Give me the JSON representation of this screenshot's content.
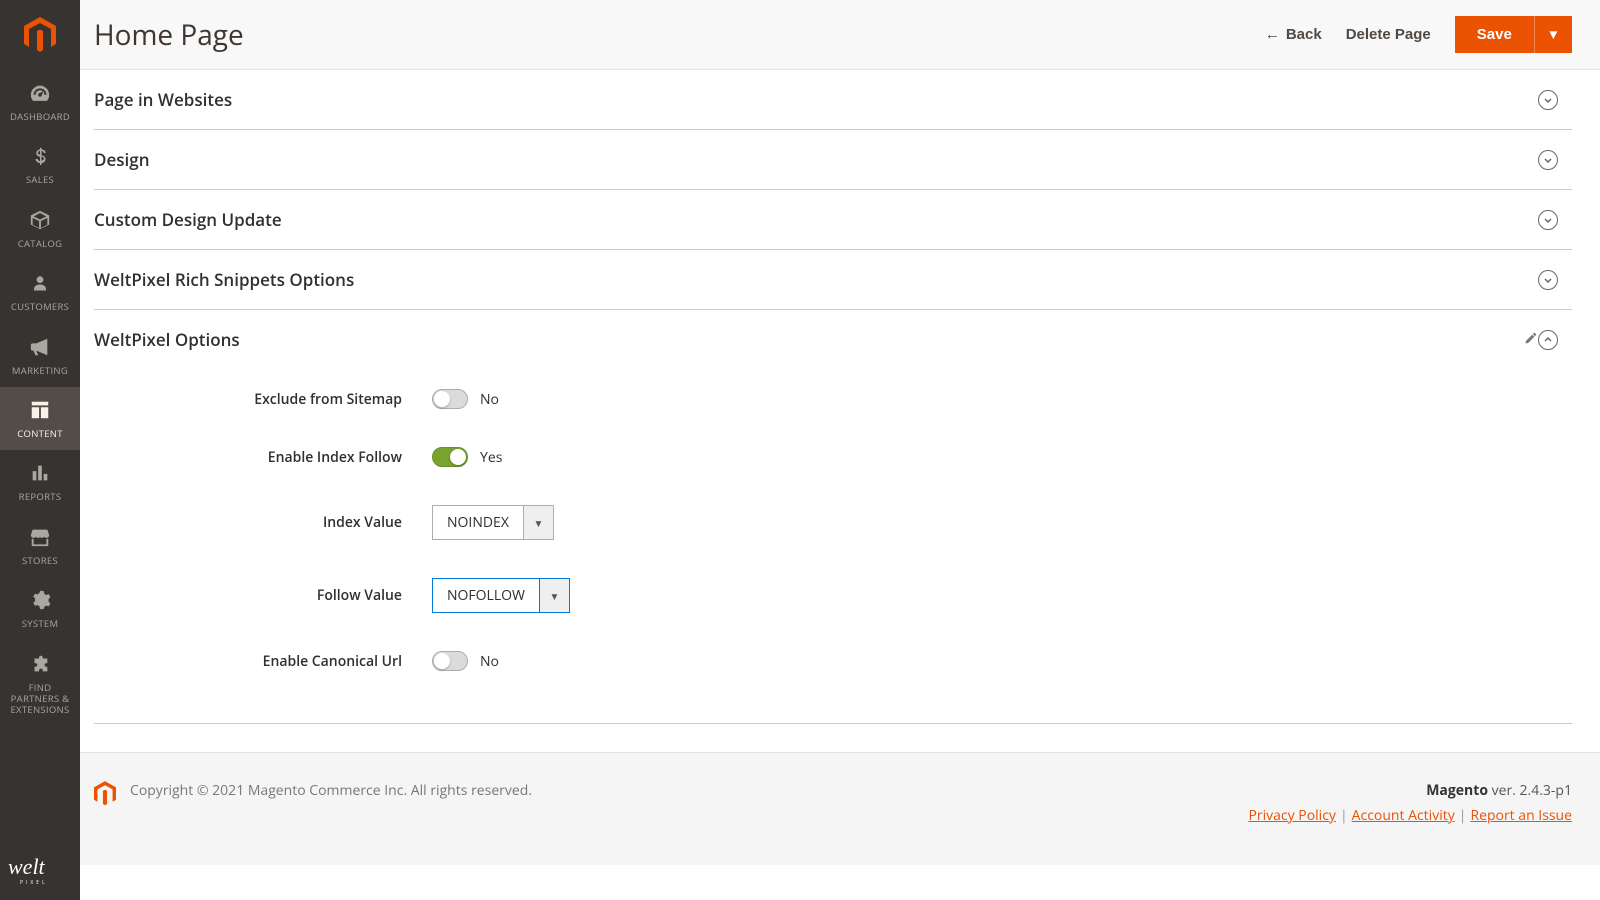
{
  "header": {
    "title": "Home Page",
    "back": "Back",
    "delete": "Delete Page",
    "save": "Save"
  },
  "sidebar": {
    "items": [
      {
        "label": "DASHBOARD"
      },
      {
        "label": "SALES"
      },
      {
        "label": "CATALOG"
      },
      {
        "label": "CUSTOMERS"
      },
      {
        "label": "MARKETING"
      },
      {
        "label": "CONTENT"
      },
      {
        "label": "REPORTS"
      },
      {
        "label": "STORES"
      },
      {
        "label": "SYSTEM"
      },
      {
        "label": "FIND PARTNERS & EXTENSIONS"
      }
    ]
  },
  "sections": {
    "page_in_websites": "Page in Websites",
    "design": "Design",
    "custom_design": "Custom Design Update",
    "rich_snippets": "WeltPixel Rich Snippets Options",
    "welt_options": "WeltPixel Options"
  },
  "form": {
    "exclude_sitemap": {
      "label": "Exclude from Sitemap",
      "value": "No"
    },
    "enable_index_follow": {
      "label": "Enable Index Follow",
      "value": "Yes"
    },
    "index_value": {
      "label": "Index Value",
      "value": "NOINDEX"
    },
    "follow_value": {
      "label": "Follow Value",
      "value": "NOFOLLOW"
    },
    "enable_canonical": {
      "label": "Enable Canonical Url",
      "value": "No"
    }
  },
  "footer": {
    "copyright": "Copyright © 2021 Magento Commerce Inc. All rights reserved.",
    "product": "Magento",
    "version": " ver. 2.4.3-p1",
    "privacy": "Privacy Policy",
    "activity": "Account Activity",
    "report": "Report an Issue"
  }
}
